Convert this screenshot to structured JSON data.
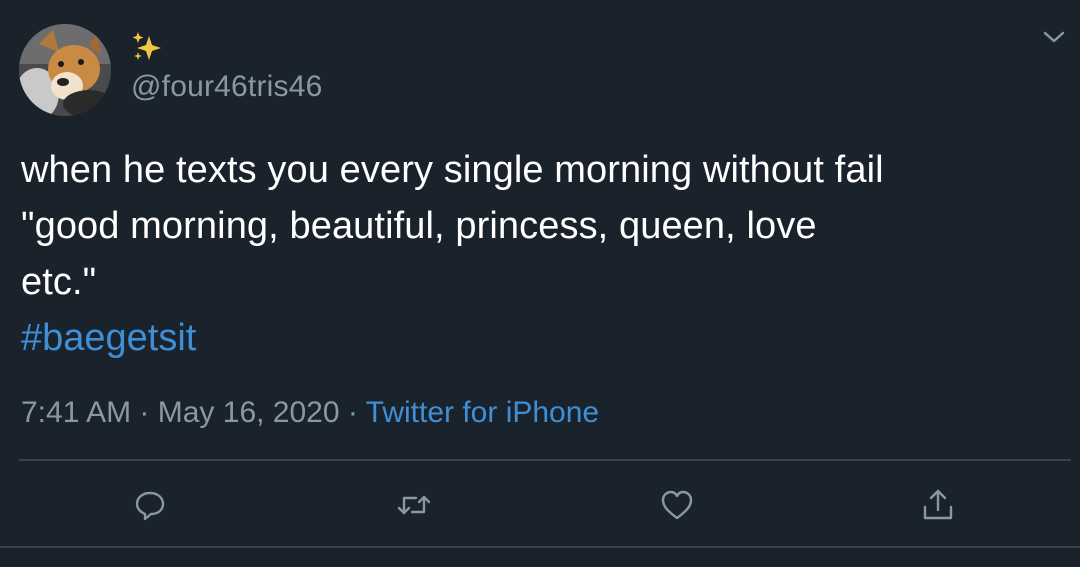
{
  "tweet": {
    "handle": "@four46tris46",
    "name_emoji": "sparkles-icon",
    "text_lines": [
      "when he texts you every single morning without fail",
      "\"good morning, beautiful, princess, queen, love",
      "etc.\""
    ],
    "hashtag": "#baegetsit",
    "time": "7:41 AM",
    "separator": " · ",
    "date": "May 16, 2020",
    "source": "Twitter for iPhone"
  },
  "actions": [
    {
      "icon": "reply-icon"
    },
    {
      "icon": "retweet-icon"
    },
    {
      "icon": "like-icon"
    },
    {
      "icon": "share-icon"
    }
  ],
  "colors": {
    "background": "#1a222c",
    "text": "#ffffff",
    "muted": "#8899a6",
    "link": "#3f8fd6",
    "divider": "#38444d"
  }
}
